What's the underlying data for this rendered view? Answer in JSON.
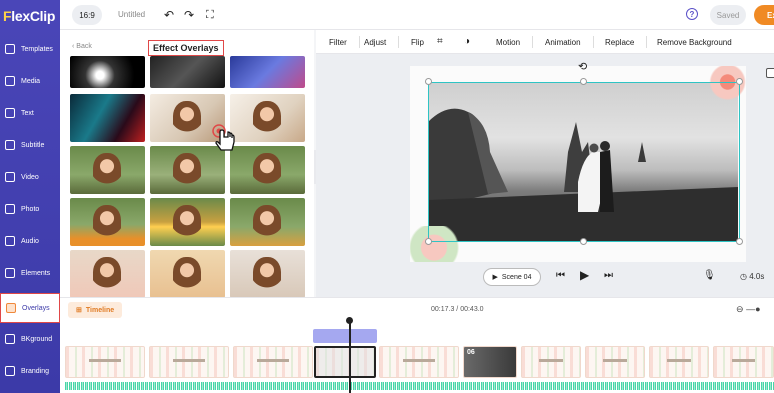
{
  "app": {
    "logo_prefix": "F",
    "logo_rest": "lexClip",
    "aspect_ratio": "16:9",
    "doc_title": "Untitled",
    "saved_label": "Saved",
    "export_label": "Exp",
    "help_label": "?"
  },
  "sidebar": {
    "items": [
      {
        "label": "Templates",
        "icon": "templates-icon"
      },
      {
        "label": "Media",
        "icon": "media-icon"
      },
      {
        "label": "Text",
        "icon": "text-icon"
      },
      {
        "label": "Subtitle",
        "icon": "subtitle-icon"
      },
      {
        "label": "Video",
        "icon": "video-icon"
      },
      {
        "label": "Photo",
        "icon": "photo-icon"
      },
      {
        "label": "Audio",
        "icon": "audio-icon"
      },
      {
        "label": "Elements",
        "icon": "elements-icon"
      },
      {
        "label": "Overlays",
        "icon": "overlays-icon",
        "active": true
      },
      {
        "label": "BKground",
        "icon": "background-icon"
      },
      {
        "label": "Branding",
        "icon": "branding-icon"
      }
    ]
  },
  "panel": {
    "back_label": "Back",
    "title": "Effect Overlays"
  },
  "edit_toolbar": {
    "filter": "Filter",
    "adjust": "Adjust",
    "flip": "Flip",
    "motion": "Motion",
    "animation": "Animation",
    "replace": "Replace",
    "remove_bg": "Remove Background"
  },
  "player": {
    "scene_label": "Scene 04",
    "duration": "4.0s"
  },
  "timeline": {
    "tab_label": "Timeline",
    "time_display": "00:17.3 / 00:43.0",
    "clip_number": "06"
  },
  "colors": {
    "sidebar": "#4440b0",
    "accent": "#f08a24",
    "selection": "#2ec4c4",
    "highlight_border": "#e04848"
  }
}
